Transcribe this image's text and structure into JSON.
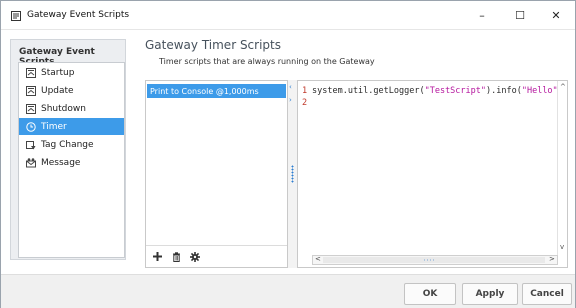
{
  "window": {
    "title": "Gateway Event Scripts",
    "controls": {
      "minimize": "–",
      "maximize": "☐",
      "close": "✕"
    },
    "icon": "script-window-icon"
  },
  "sidebar": {
    "heading": "Gateway Event Scripts",
    "items": [
      {
        "label": "Startup",
        "icon": "script-page-icon",
        "selected": false
      },
      {
        "label": "Update",
        "icon": "script-page-icon",
        "selected": false
      },
      {
        "label": "Shutdown",
        "icon": "script-page-icon",
        "selected": false
      },
      {
        "label": "Timer",
        "icon": "clock-icon",
        "selected": true
      },
      {
        "label": "Tag Change",
        "icon": "tag-change-icon",
        "selected": false
      },
      {
        "label": "Message",
        "icon": "message-icon",
        "selected": false
      }
    ]
  },
  "main": {
    "title": "Gateway Timer Scripts",
    "subtitle": "Timer scripts that are always running on the Gateway",
    "script_list": [
      {
        "label": "Print to Console @1,000ms",
        "selected": true
      }
    ],
    "list_tools": {
      "add": "+",
      "delete": "🗑",
      "settings": "⚙"
    }
  },
  "editor": {
    "line_numbers": [
      "1",
      "2"
    ],
    "code": {
      "line1_prefix": "system.util.getLogger(",
      "line1_str1": "\"TestScript\"",
      "line1_mid": ").info(",
      "line1_str2": "\"Hello\"",
      "line1_suffix": ")"
    }
  },
  "footer": {
    "ok": "OK",
    "apply": "Apply",
    "cancel": "Cancel"
  },
  "colors": {
    "selection": "#3d9be9",
    "line_number": "#c0392b",
    "string": "#b5179e",
    "title": "#46515c"
  }
}
